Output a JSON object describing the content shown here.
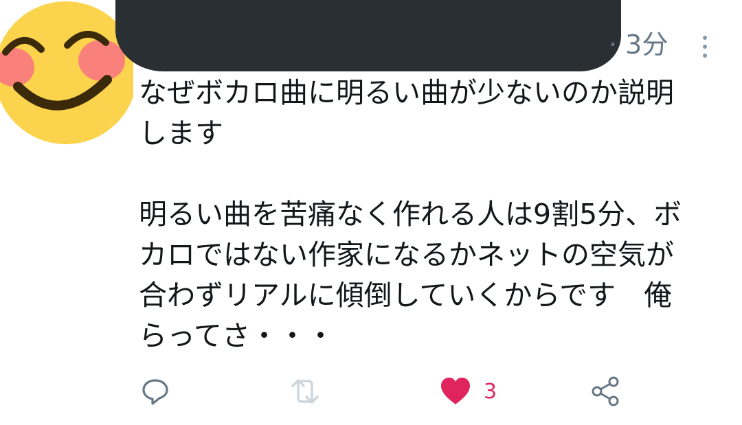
{
  "tweet": {
    "time": "· 3分",
    "lines": [
      "なぜボカロ曲に明るい曲が少ないのか説明",
      "します",
      "明るい曲を苦痛なく作れる人は9割5分、ボ",
      "カロではない作家になるかネットの空気が",
      "合わずリアルに傾倒していくからです　俺",
      "らってさ・・・"
    ]
  },
  "actions": {
    "reply_icon": "reply-icon",
    "retweet_icon": "retweet-icon",
    "like_icon": "heart-icon",
    "like_count": "3",
    "share_icon": "share-icon"
  },
  "colors": {
    "text": "#14171a",
    "muted": "#657786",
    "like": "#e0245e",
    "redaction": "#2a2f33",
    "avatar_face": "#fcd34d",
    "avatar_blush": "#f87171"
  }
}
